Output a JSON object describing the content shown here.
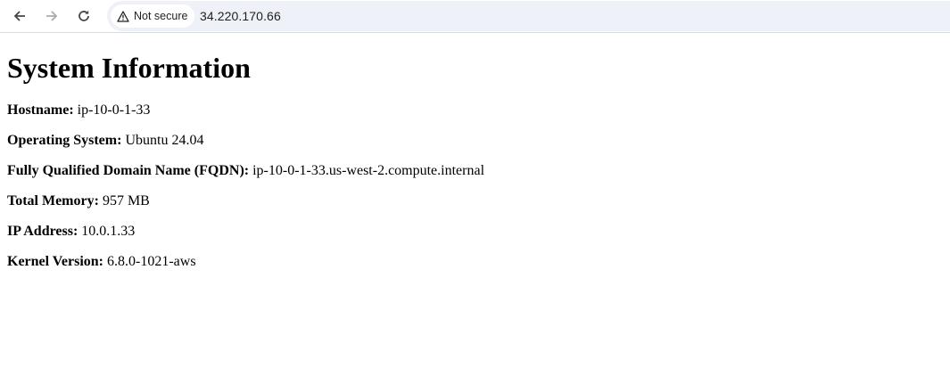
{
  "browser": {
    "security_label": "Not secure",
    "url": "34.220.170.66",
    "icons": {
      "back": "arrow-left-icon",
      "forward": "arrow-right-icon",
      "reload": "reload-icon",
      "security": "warning-triangle-icon"
    }
  },
  "page": {
    "title": "System Information",
    "fields": [
      {
        "label": "Hostname:",
        "value": "ip-10-0-1-33"
      },
      {
        "label": "Operating System:",
        "value": "Ubuntu 24.04"
      },
      {
        "label": "Fully Qualified Domain Name (FQDN):",
        "value": "ip-10-0-1-33.us-west-2.compute.internal"
      },
      {
        "label": "Total Memory:",
        "value": "957 MB"
      },
      {
        "label": "IP Address:",
        "value": "10.0.1.33"
      },
      {
        "label": "Kernel Version:",
        "value": "6.8.0-1021-aws"
      }
    ]
  }
}
